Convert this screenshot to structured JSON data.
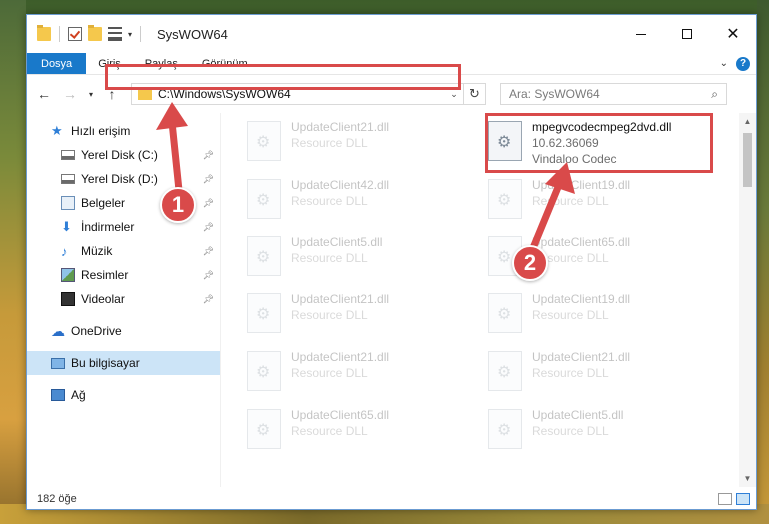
{
  "window": {
    "title": "SysWOW64"
  },
  "ribbon": {
    "tabs": [
      "Dosya",
      "Giriş",
      "Paylaş",
      "Görünüm"
    ]
  },
  "address": {
    "path": "C:\\Windows\\SysWOW64"
  },
  "search": {
    "placeholder": "Ara: SysWOW64"
  },
  "sidebar": {
    "items": [
      {
        "label": "Hızlı erişim",
        "icon": "star-icon"
      },
      {
        "label": "Yerel Disk (C:)",
        "icon": "disk-icon",
        "pinned": true
      },
      {
        "label": "Yerel Disk (D:)",
        "icon": "disk-icon",
        "pinned": true
      },
      {
        "label": "Belgeler",
        "icon": "document-icon",
        "pinned": true
      },
      {
        "label": "İndirmeler",
        "icon": "download-icon",
        "pinned": true
      },
      {
        "label": "Müzik",
        "icon": "music-icon",
        "pinned": true
      },
      {
        "label": "Resimler",
        "icon": "pictures-icon",
        "pinned": true
      },
      {
        "label": "Videolar",
        "icon": "video-icon",
        "pinned": true
      },
      {
        "label": "OneDrive",
        "icon": "cloud-icon"
      },
      {
        "label": "Bu bilgisayar",
        "icon": "computer-icon",
        "selected": true
      },
      {
        "label": "Ağ",
        "icon": "network-icon"
      }
    ]
  },
  "files": {
    "highlighted": {
      "name": "mpegvcodecmpeg2dvd.dll",
      "version": "10.62.36069",
      "company": "Vindaloo Codec"
    },
    "left_column": [
      {
        "name": "UpdateClient21.dll",
        "desc": "Resource DLL"
      },
      {
        "name": "UpdateClient42.dll",
        "desc": "Resource DLL"
      },
      {
        "name": "UpdateClient5.dll",
        "desc": "Resource DLL"
      },
      {
        "name": "UpdateClient21.dll",
        "desc": "Resource DLL"
      },
      {
        "name": "UpdateClient21.dll",
        "desc": "Resource DLL"
      },
      {
        "name": "UpdateClient65.dll",
        "desc": "Resource DLL"
      }
    ],
    "right_column": [
      {
        "name": "UpdateClient19.dll",
        "desc": "Resource DLL"
      },
      {
        "name": "UpdateClient65.dll",
        "desc": "Resource DLL"
      },
      {
        "name": "UpdateClient19.dll",
        "desc": "Resource DLL"
      },
      {
        "name": "UpdateClient21.dll",
        "desc": "Resource DLL"
      },
      {
        "name": "UpdateClient5.dll",
        "desc": "Resource DLL"
      }
    ]
  },
  "status": {
    "count": "182 öğe"
  },
  "annotations": {
    "badge1": "1",
    "badge2": "2",
    "color": "#d94a4a"
  }
}
